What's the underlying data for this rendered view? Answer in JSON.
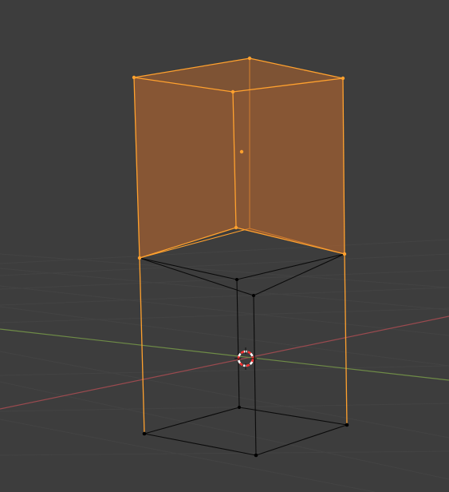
{
  "viewport": {
    "background_color": "#3d3d3d",
    "grid_line_color": "#454545",
    "x_axis_color": "#9a4a4f",
    "y_axis_color": "#6f8c47"
  },
  "mesh": {
    "selected_color": "#ffa12e",
    "selected_face_fill": "#b4662e",
    "unselected_edge_color": "#0a0a0a",
    "vertex_color": "#000000"
  },
  "overlays": {
    "origin_color": "#ffa12e",
    "cursor_ring_colors": [
      "#ff3030",
      "#ffffff"
    ],
    "cursor_cross_color": "#111111",
    "cursor_icon": "3d-cursor-icon",
    "origin_icon": "object-origin-dot"
  }
}
